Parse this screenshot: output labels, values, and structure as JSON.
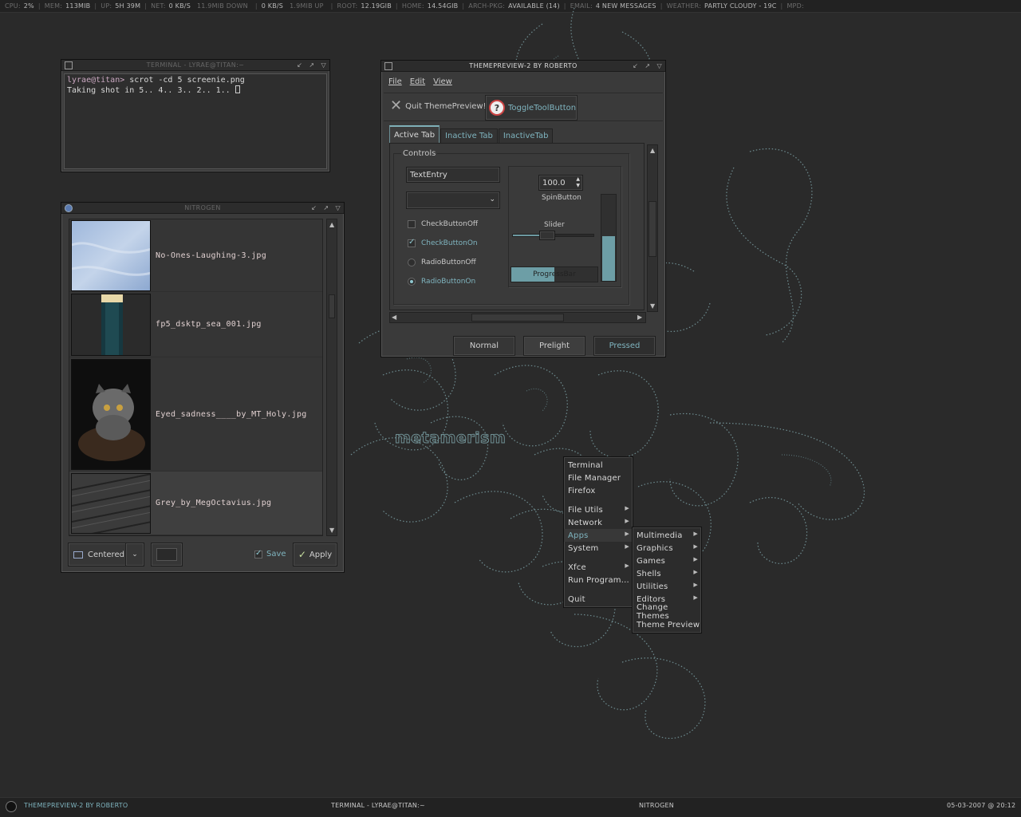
{
  "topbar": [
    {
      "k": "CPU:",
      "v": "2%"
    },
    {
      "k": "MEM:",
      "v": "113MIB"
    },
    {
      "k": "UP:",
      "v": "5H 39M"
    },
    {
      "k": "NET:",
      "v": "0 KB/S",
      "extra": "11.9MIB DOWN"
    },
    {
      "k": "",
      "v": "0 KB/S",
      "extra": "1.9MIB UP"
    },
    {
      "k": "ROOT:",
      "v": "12.19GIB",
      "k2": "HOME:",
      "v2": "14.54GIB"
    },
    {
      "k": "ARCH-PKG:",
      "v": "AVAILABLE (14)"
    },
    {
      "k": "EMAIL:",
      "v": "4 NEW MESSAGES"
    },
    {
      "k": "WEATHER:",
      "v": "PARTLY CLOUDY - 19C"
    },
    {
      "k": "MPD:",
      "v": ""
    }
  ],
  "wallpaper_logo": "metamerism",
  "terminal": {
    "title": "TERMINAL - LYRAE@TITAN:~",
    "prompt": "lyrae@titan>",
    "command": " scrot -cd 5 screenie.png",
    "output": "Taking shot in 5.. 4.. 3.. 2.. 1.. "
  },
  "nitrogen": {
    "title": "NITROGEN",
    "items": [
      "No-Ones-Laughing-3.jpg",
      "fp5_dsktp_sea_001.jpg",
      "Eyed_sadness____by_MT_Holy.jpg",
      "Grey_by_MegOctavius.jpg"
    ],
    "mode": "Centered",
    "save": "Save",
    "apply": "Apply"
  },
  "themepreview": {
    "title": "THEMEPREVIEW-2 BY ROBERTO",
    "menu": [
      "File",
      "Edit",
      "View"
    ],
    "quit": "Quit ThemePreview!",
    "toggle": "ToggleToolButton",
    "tabs": [
      "Active Tab",
      "Inactive Tab",
      "InactiveTab"
    ],
    "controls": "Controls",
    "text_entry": "TextEntry",
    "checkbox_off": "CheckButtonOff",
    "checkbox_on": "CheckButtonOn",
    "radio_off": "RadioButtonOff",
    "radio_on": "RadioButtonOn",
    "spin_value": "100.0",
    "spin_label": "SpinButton",
    "slider_label": "Slider",
    "slider_value": 0.42,
    "progress_label": "ProgressBar",
    "progress_value": 0.5,
    "vbar_value": 0.52,
    "btn_normal": "Normal",
    "btn_prelight": "Prelight",
    "btn_pressed": "Pressed"
  },
  "menu_main": [
    {
      "label": "Terminal"
    },
    {
      "label": "File Manager"
    },
    {
      "label": "Firefox",
      "gap": true
    },
    {
      "label": "File Utils",
      "sub": true
    },
    {
      "label": "Network",
      "sub": true
    },
    {
      "label": "Apps",
      "sub": true,
      "hl": true
    },
    {
      "label": "System",
      "sub": true,
      "gap": true
    },
    {
      "label": "Xfce",
      "sub": true
    },
    {
      "label": "Run Program...",
      "gap": true
    },
    {
      "label": "Quit"
    }
  ],
  "menu_apps": [
    {
      "label": "Multimedia",
      "sub": true
    },
    {
      "label": "Graphics",
      "sub": true
    },
    {
      "label": "Games",
      "sub": true
    },
    {
      "label": "Shells",
      "sub": true
    },
    {
      "label": "Utilities",
      "sub": true
    },
    {
      "label": "Editors",
      "sub": true
    },
    {
      "label": "Change Themes"
    },
    {
      "label": "Theme Preview"
    }
  ],
  "bottombar": {
    "task1": "THEMEPREVIEW-2 BY ROBERTO",
    "task2": "TERMINAL - LYRAE@TITAN:~",
    "task3": "NITROGEN",
    "clock": "05-03-2007 @ 20:12"
  },
  "colors": {
    "accent": "#7fb4bf",
    "bg": "#2a2a2a",
    "panel": "#3a3a3a"
  }
}
